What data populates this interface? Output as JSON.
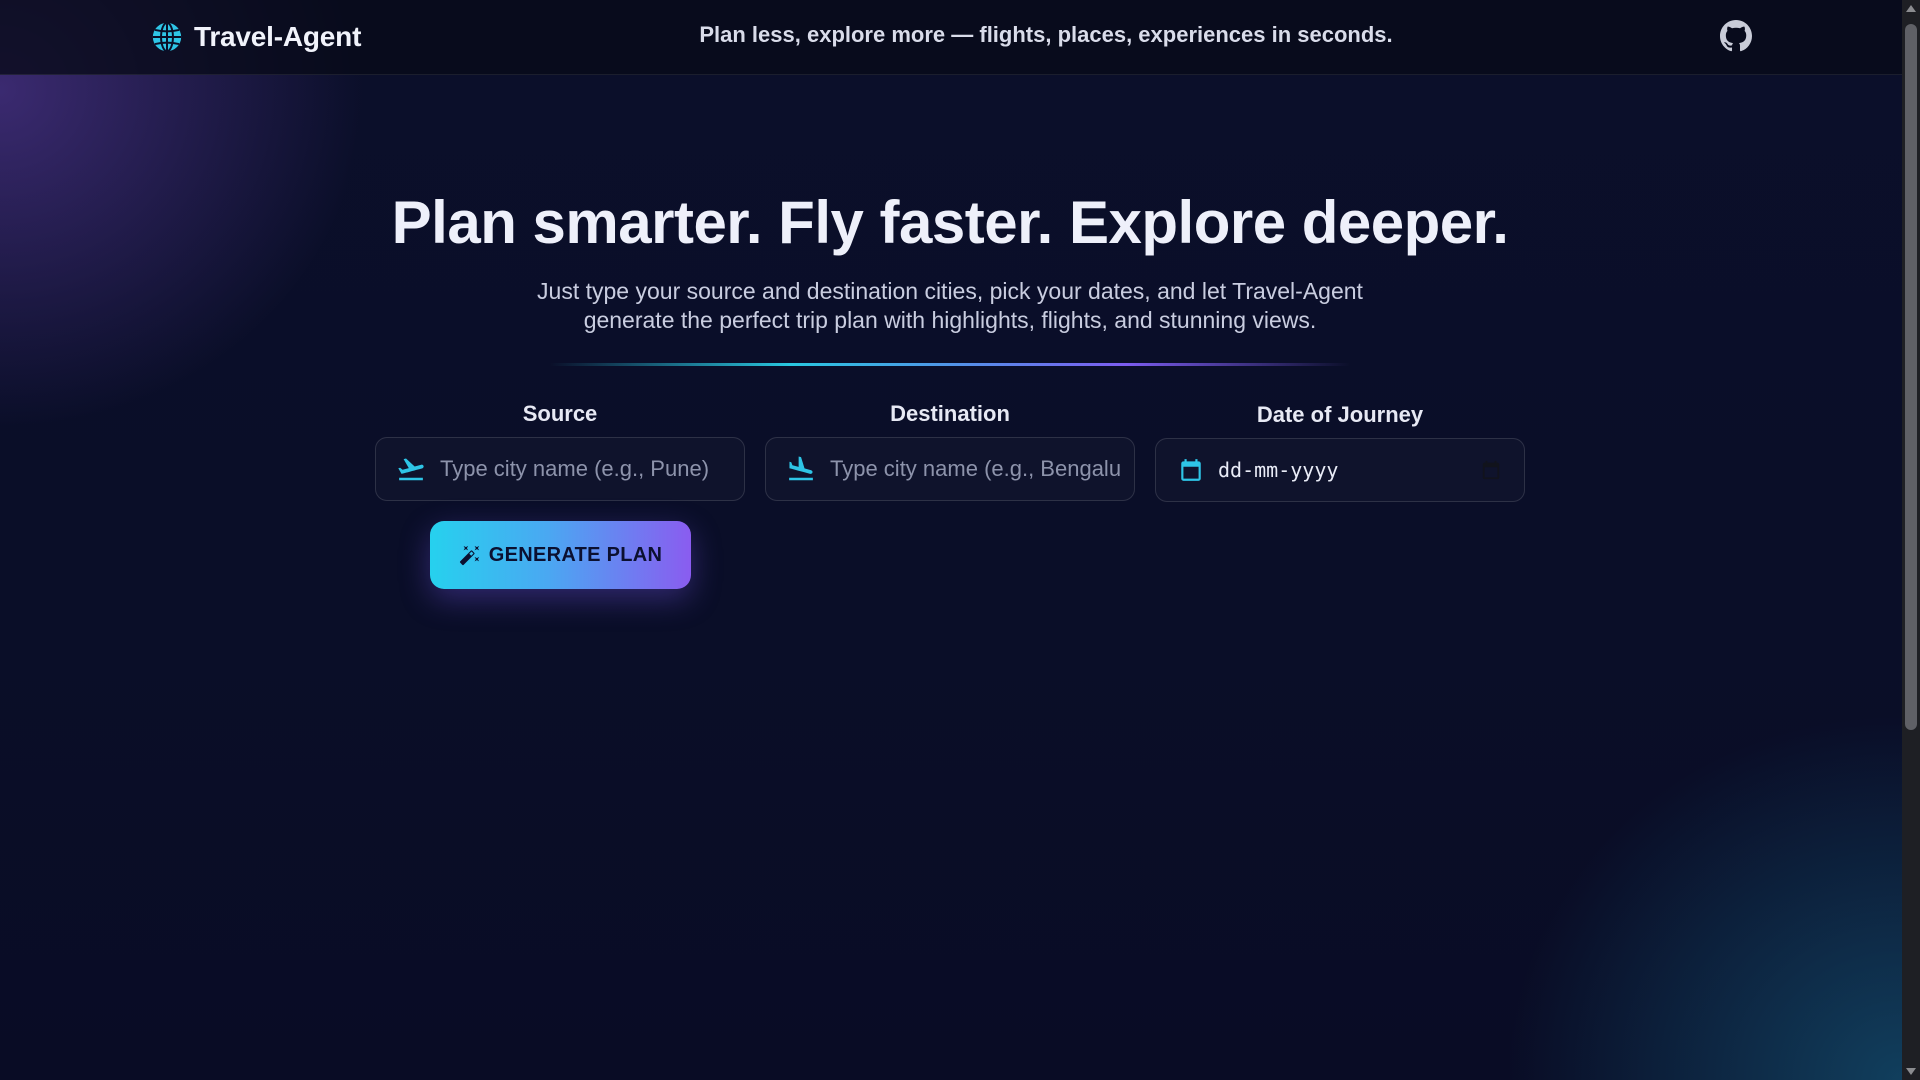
{
  "header": {
    "brand_name": "Travel-Agent",
    "brand_icon": "globe-icon",
    "tagline": "Plan less, explore more — flights, places, experiences in seconds.",
    "github_icon": "github-icon"
  },
  "hero": {
    "title": "Plan smarter. Fly faster. Explore deeper.",
    "subtitle": "Just type your source and destination cities, pick your dates, and let Travel-Agent generate the perfect trip plan with highlights, flights, and stunning views."
  },
  "form": {
    "source": {
      "label": "Source",
      "placeholder": "Type city name (e.g., Pune)",
      "value": "",
      "icon": "plane-departure-icon"
    },
    "destination": {
      "label": "Destination",
      "placeholder": "Type city name (e.g., Bengaluru)",
      "value": "",
      "icon": "plane-arrival-icon"
    },
    "date": {
      "label": "Date of Journey",
      "value": "dd-mm-yyyy",
      "icon": "calendar-icon",
      "picker_icon": "calendar-picker-icon"
    },
    "generate_button": {
      "label": "GENERATE PLAN",
      "icon": "magic-wand-icon"
    }
  },
  "colors": {
    "accent_cyan": "#26d1ee",
    "accent_violet": "#8a5cf0",
    "background": "#0a0e26"
  }
}
